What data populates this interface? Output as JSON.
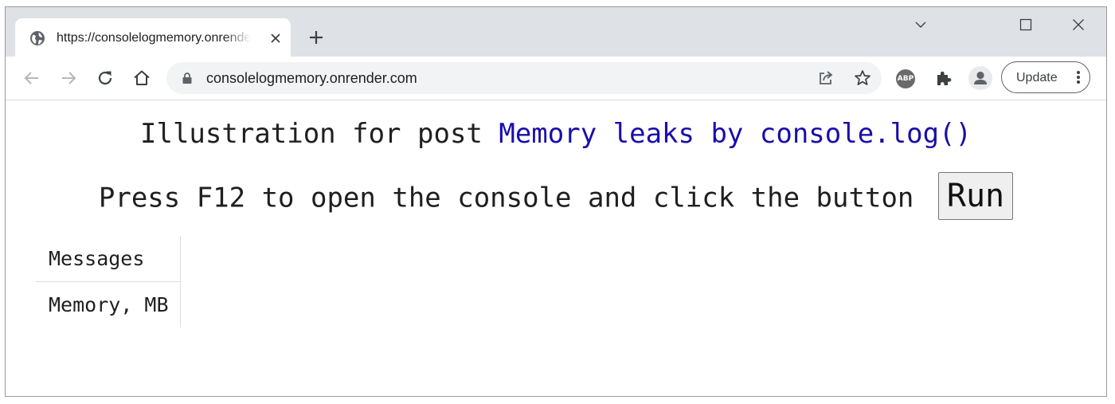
{
  "browser": {
    "tab": {
      "title": "https://consolelogmemory.onrender.com",
      "favicon": "globe-icon"
    },
    "address_bar": {
      "url": "consolelogmemory.onrender.com"
    },
    "toolbar": {
      "update_label": "Update",
      "extension_badge": "ABP"
    }
  },
  "page": {
    "heading_prefix": "Illustration for post ",
    "heading_link": "Memory leaks by console.log()",
    "instruction": "Press F12 to open the console and click the button ",
    "run_button": "Run",
    "table": {
      "rows": [
        {
          "label": "Messages"
        },
        {
          "label": "Memory, MB"
        }
      ]
    }
  },
  "colors": {
    "link": "#1a0dab",
    "tabstrip": "#dee1e6",
    "omnibox": "#f1f3f4"
  }
}
